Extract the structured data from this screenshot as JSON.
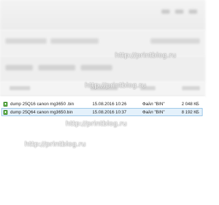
{
  "files": [
    {
      "name": "dump 25Q16 canon mg3650 .bin",
      "date": "15.08.2016 10:26",
      "type": "Файл \"BIN\"",
      "size": "2 048 КБ",
      "selected": false
    },
    {
      "name": "dump 25Q64 canon mg3650.bin",
      "date": "15.08.2016 10:37",
      "type": "Файл \"BIN\"",
      "size": "8 192 КБ",
      "selected": true
    }
  ],
  "watermark": {
    "text": "http://printblog.ru"
  },
  "colors": {
    "selection_bg": "#e4f1fb",
    "selection_border": "#9cc7e8",
    "file_icon": "#5fb04a"
  },
  "icons": {
    "file": "bin-file-icon"
  }
}
